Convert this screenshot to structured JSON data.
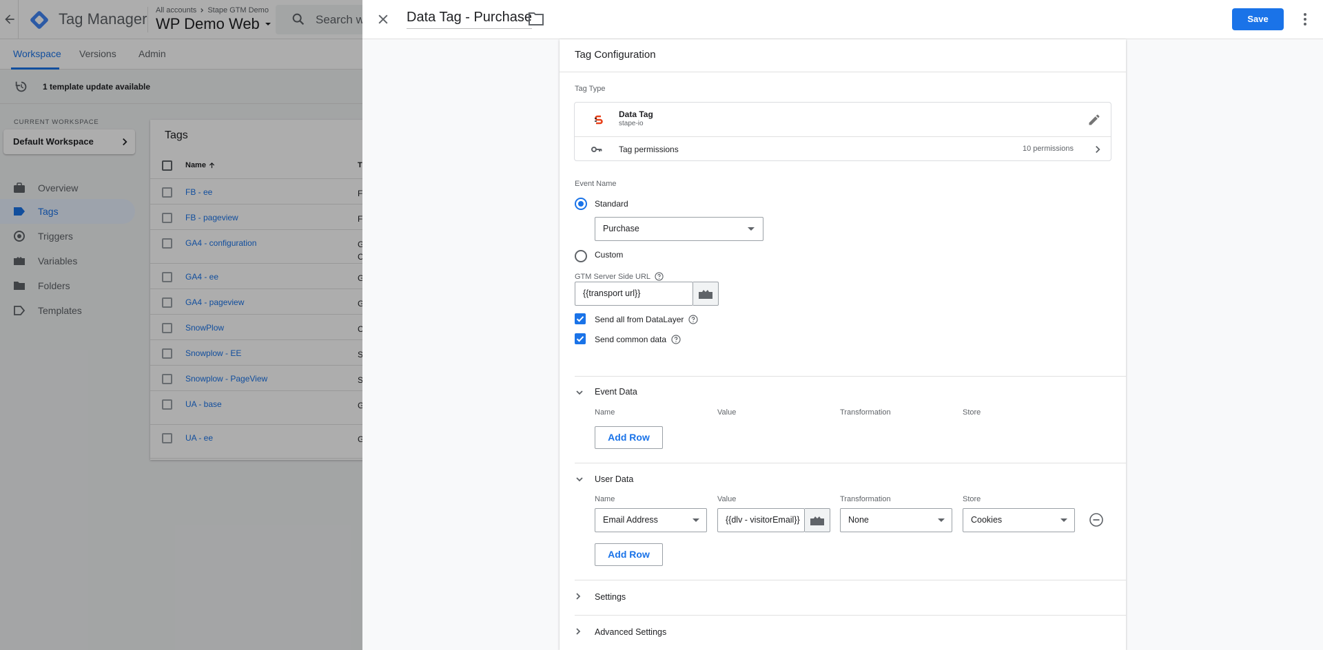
{
  "app": {
    "title": "Tag Manager",
    "breadcrumb_account": "All accounts",
    "breadcrumb_container": "Stape GTM Demo",
    "container_name": "WP Demo Web",
    "search_placeholder": "Search wo"
  },
  "nav": {
    "tabs": [
      "Workspace",
      "Versions",
      "Admin"
    ],
    "active": "Workspace"
  },
  "update_notice": "1 template update available",
  "sidebar": {
    "current_workspace_label": "CURRENT WORKSPACE",
    "workspace_name": "Default Workspace",
    "items": [
      {
        "label": "Overview",
        "icon": "briefcase-icon"
      },
      {
        "label": "Tags",
        "icon": "tag-icon",
        "active": true
      },
      {
        "label": "Triggers",
        "icon": "trigger-icon"
      },
      {
        "label": "Variables",
        "icon": "variables-icon"
      },
      {
        "label": "Folders",
        "icon": "folder-icon"
      },
      {
        "label": "Templates",
        "icon": "template-icon"
      }
    ]
  },
  "tags_list": {
    "title": "Tags",
    "col_name": "Name",
    "col_type": "T",
    "rows": [
      {
        "name": "FB - ee",
        "type": "F"
      },
      {
        "name": "FB - pageview",
        "type": "F"
      },
      {
        "name": "GA4 - configuration",
        "type": "G C"
      },
      {
        "name": "GA4 - ee",
        "type": "G"
      },
      {
        "name": "GA4 - pageview",
        "type": "G"
      },
      {
        "name": "SnowPlow",
        "type": "C"
      },
      {
        "name": "Snowplow - EE",
        "type": "S"
      },
      {
        "name": "Snowplow - PageView",
        "type": "S"
      },
      {
        "name": "UA - base",
        "type": "G A"
      },
      {
        "name": "UA - ee",
        "type": "G A"
      }
    ]
  },
  "sheet": {
    "title": "Data Tag - Purchase",
    "save_label": "Save"
  },
  "config": {
    "card_title": "Tag Configuration",
    "tag_type_label": "Tag Type",
    "tag_type_name": "Data Tag",
    "tag_type_vendor": "stape-io",
    "permissions_label": "Tag permissions",
    "permissions_count": "10 permissions",
    "event_name_label": "Event Name",
    "standard_label": "Standard",
    "standard_value": "Purchase",
    "custom_label": "Custom",
    "url_label": "GTM Server Side URL",
    "url_value": "{{transport url}}",
    "send_all_label": "Send all from DataLayer",
    "send_common_label": "Send common data",
    "event_data": {
      "title": "Event Data",
      "columns": [
        "Name",
        "Value",
        "Transformation",
        "Store"
      ],
      "add_row": "Add Row"
    },
    "user_data": {
      "title": "User Data",
      "columns": [
        "Name",
        "Value",
        "Transformation",
        "Store"
      ],
      "row": {
        "name": "Email Address",
        "value": "{{dlv - visitorEmail}}",
        "transformation": "None",
        "store": "Cookies"
      },
      "add_row": "Add Row"
    },
    "settings_label": "Settings",
    "advanced_label": "Advanced Settings"
  },
  "colors": {
    "accent": "#1a73e8",
    "scrim": "rgba(0,0,0,0.32)"
  }
}
